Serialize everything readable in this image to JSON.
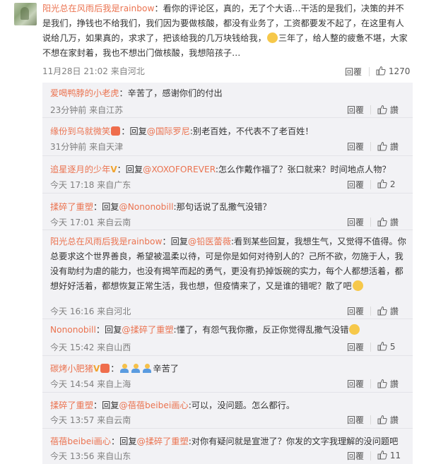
{
  "main_comment": {
    "username": "阳光总在风雨后我是rainbow",
    "text": "：看你的评论区，真的，无了个大语…干活的是我们，决策的并不是我们，挣钱也不给我们，我们因为要做核酸，都没有业务了，工资都要发不起了，在这里有人说给几万，如果真的，求求了，把该给我的几万块钱给我，",
    "text_after_emoji": "三年了，给人整的疲惫不堪，大家不想在家封着，我也不想出门做核酸，我想陪孩子…",
    "time": "11月28日 21:02 来自河北",
    "reply_label": "回覆",
    "likes": "1270"
  },
  "replies": [
    {
      "user": "爱喝鸭脖的小老虎",
      "pre": "",
      "at": "",
      "text": "：辛苦了，感谢你们的付出",
      "time": "23分钟前 来自江苏",
      "reply": "回覆",
      "like": "讚"
    },
    {
      "user": "缘份到乌就微笑",
      "pre": "：回复",
      "at": "@国际罗尼",
      "text": ":别老百姓，不代表不了老百姓！",
      "time": "31分钟前 来自天津",
      "reply": "回覆",
      "like": "讚"
    },
    {
      "user": "追星逐月的少年",
      "pre": "：回复",
      "at": "@XOXOFOREVER",
      "text": ":怎么作戴作福了？张口就来？时间地点人物？",
      "time": "今天 17:18 来自广东",
      "reply": "回覆",
      "like": "2"
    },
    {
      "user": "揉碎了重塑",
      "pre": "：回复",
      "at": "@Nononobill",
      "text": ":那句话说了乱撒气没错？",
      "time": "今天 17:01 来自云南",
      "reply": "回覆",
      "like": "讚"
    },
    {
      "user": "阳光总在风雨后我是rainbow",
      "pre": "：回复",
      "at": "@铅医蕾薇",
      "text": ":看到某些回复，我想生气，又觉得不值得。你总要求这个世界善良，希望被温柔以待，可是你是如何对待别人的？己所不欲，勿施于人，我没有助纣为虐的能力，也没有揭竿而起的勇气，更没有扔掉饭碗的实力，每个人都想活着，都想好好活着，都想恢复正常生活，我也想，但疫情来了，又是谁的错呢？散了吧",
      "time": "今天 16:16 来自河北",
      "reply": "回覆",
      "like": "讚"
    },
    {
      "user": "Nononobill",
      "pre": "：回复",
      "at": "@揉碎了重塑",
      "text": ":懂了，有怨气我你撒，反正你觉得乱撒气没错",
      "time": "今天 15:42 来自山西",
      "reply": "回覆",
      "like": "5"
    },
    {
      "user": "碳烤小肥猪",
      "pre": "：",
      "at": "",
      "text": "辛苦了",
      "time": "今天 14:54 来自上海",
      "reply": "回覆",
      "like": "讚"
    },
    {
      "user": "揉碎了重塑",
      "pre": "：回复",
      "at": "@蓓蓓beibei画心",
      "text": ":可以，没问题。怎么都行。",
      "time": "今天 13:57 来自云南",
      "reply": "回覆",
      "like": "讚"
    },
    {
      "user": "蓓蓓beibei画心",
      "pre": "：回复",
      "at": "@揉碎了重塑",
      "text": ":对你有疑问就是宣泄了？你发的文字我理解的没问题吧",
      "time": "今天 13:56 来自山东",
      "reply": "回覆",
      "like": "11"
    }
  ]
}
